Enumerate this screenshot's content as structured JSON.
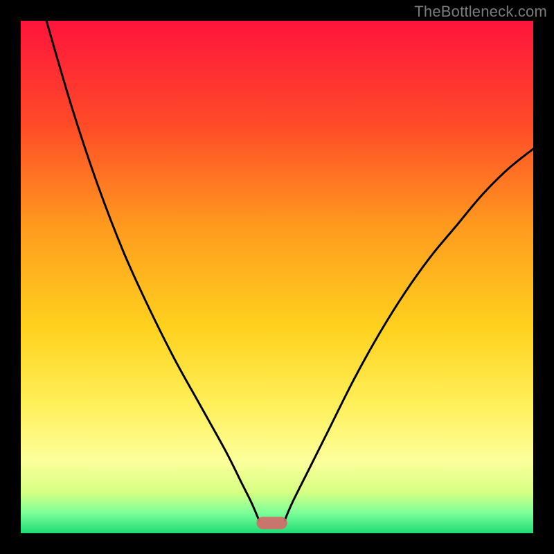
{
  "watermark": "TheBottleneck.com",
  "chart_data": {
    "type": "line",
    "title": "",
    "xlabel": "",
    "ylabel": "",
    "xlim": [
      0,
      100
    ],
    "ylim": [
      0,
      100
    ],
    "grid": false,
    "legend": null,
    "background_gradient": {
      "stops": [
        {
          "offset": 0.0,
          "color": "#ff143c"
        },
        {
          "offset": 0.2,
          "color": "#ff4a28"
        },
        {
          "offset": 0.4,
          "color": "#ff9a1e"
        },
        {
          "offset": 0.6,
          "color": "#ffd21e"
        },
        {
          "offset": 0.75,
          "color": "#fff05a"
        },
        {
          "offset": 0.86,
          "color": "#fcff9c"
        },
        {
          "offset": 0.92,
          "color": "#d6ff82"
        },
        {
          "offset": 0.96,
          "color": "#7dff9a"
        },
        {
          "offset": 1.0,
          "color": "#1ddc74"
        }
      ]
    },
    "series": [
      {
        "name": "left-curve",
        "x": [
          5,
          10,
          15,
          20,
          25,
          30,
          35,
          40,
          43,
          45,
          46.5
        ],
        "values": [
          100,
          83,
          68,
          55,
          44,
          34,
          25,
          16,
          10,
          6,
          2.5
        ]
      },
      {
        "name": "right-curve",
        "x": [
          51.5,
          53,
          56,
          60,
          65,
          70,
          75,
          80,
          85,
          90,
          95,
          100
        ],
        "values": [
          2.5,
          6,
          12,
          20,
          30,
          39,
          47,
          54,
          60,
          66,
          71,
          75
        ]
      }
    ],
    "marker": {
      "name": "minimum-marker",
      "x_range": [
        46,
        52
      ],
      "y": 2,
      "color": "#d46a6a"
    }
  }
}
